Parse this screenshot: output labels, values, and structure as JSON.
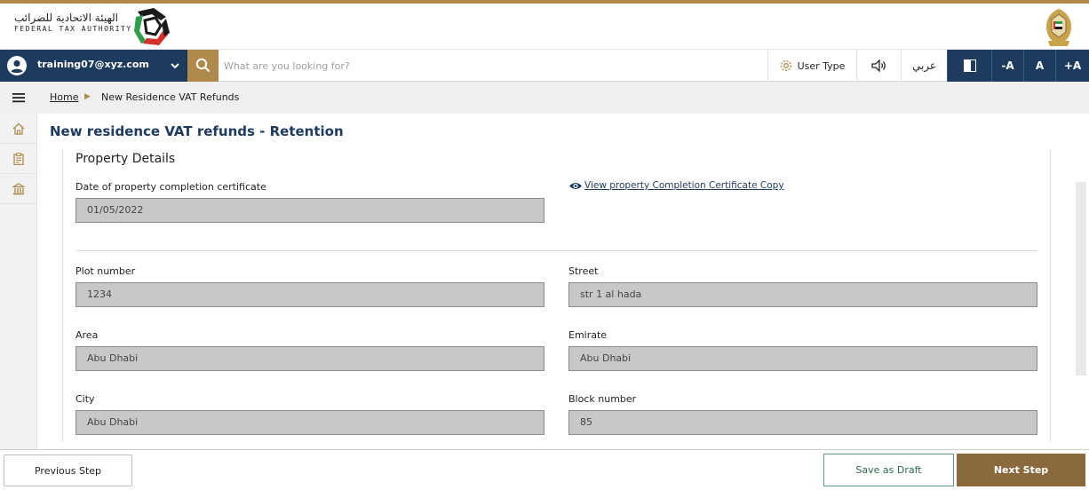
{
  "header": {
    "logo_ar": "الهيئة الاتحادية للضرائب",
    "logo_en": "FEDERAL TAX AUTHORITY"
  },
  "navbar": {
    "user_email": "training07@xyz.com",
    "search_placeholder": "What are you looking for?",
    "user_type": "User Type",
    "arabic": "عربي",
    "font_minus": "-A",
    "font_normal": "A",
    "font_plus": "+A"
  },
  "breadcrumb": {
    "home": "Home",
    "current": "New Residence VAT Refunds"
  },
  "page": {
    "title": "New residence VAT refunds - Retention",
    "section_title": "Property Details",
    "view_link": "View property Completion Certificate Copy",
    "fields": {
      "completion_date": {
        "label": "Date of property completion certificate",
        "value": "01/05/2022"
      },
      "plot_number": {
        "label": "Plot number",
        "value": "1234"
      },
      "street": {
        "label": "Street",
        "value": "str 1 al hada"
      },
      "area": {
        "label": "Area",
        "value": "Abu Dhabi"
      },
      "emirate": {
        "label": "Emirate",
        "value": "Abu Dhabi"
      },
      "city": {
        "label": "City",
        "value": "Abu Dhabi"
      },
      "block_number": {
        "label": "Block number",
        "value": "85"
      }
    }
  },
  "footer": {
    "previous": "Previous Step",
    "draft": "Save as Draft",
    "next": "Next Step"
  },
  "colors": {
    "navy": "#1d3a5f",
    "gold": "#b08a4a",
    "next_button": "#8a6a3d",
    "draft_border": "#5aa17a"
  },
  "icons": {
    "logo": "fta-logo-mark",
    "emblem": "uae-emblem",
    "avatar": "user-avatar-icon",
    "search": "search-icon",
    "menu": "hamburger-icon",
    "home": "home-icon",
    "clipboard": "clipboard-icon",
    "bank": "bank-icon"
  }
}
